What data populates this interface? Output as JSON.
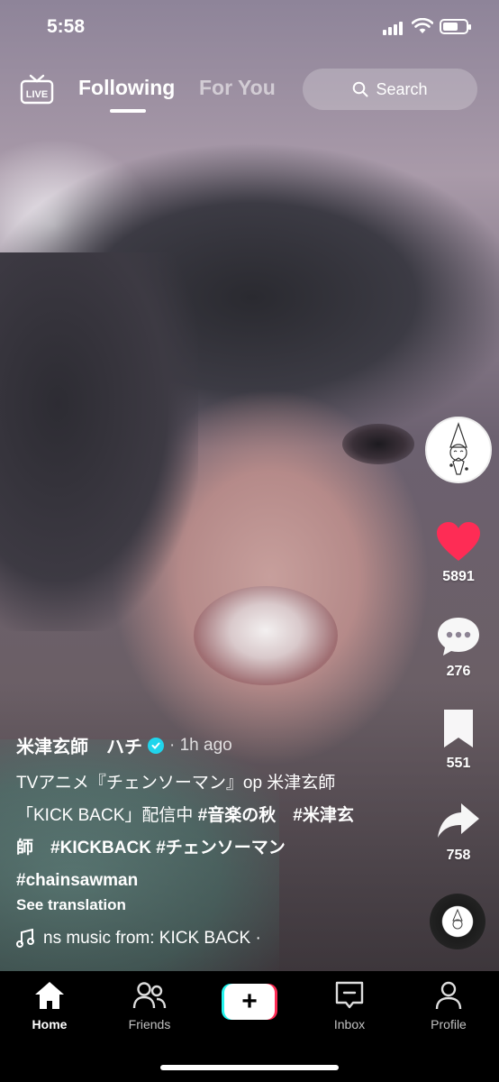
{
  "status_bar": {
    "time": "5:58"
  },
  "top_nav": {
    "live_label": "LIVE",
    "tabs": [
      {
        "label": "Following",
        "active": true
      },
      {
        "label": "For You",
        "active": false
      }
    ],
    "search_label": "Search"
  },
  "rail": {
    "likes": "5891",
    "comments": "276",
    "saves": "551",
    "shares": "758"
  },
  "post": {
    "username": "米津玄師　ハチ",
    "time_ago": "· 1h ago",
    "caption_text_1": "TVアニメ『チェンソーマン』op 米津玄師「KICK BACK」配信中 ",
    "caption_tags": [
      "#音楽の秋",
      "#米津玄師",
      "#KICKBACK",
      "#チェンソーマン",
      "#chainsawman"
    ],
    "see_translation": "See translation",
    "music": "ns music from: KICK BACK ·"
  },
  "bottom_nav": {
    "items": [
      {
        "label": "Home",
        "icon": "home-icon",
        "active": true
      },
      {
        "label": "Friends",
        "icon": "friends-icon",
        "active": false
      },
      {
        "label": "Inbox",
        "icon": "inbox-icon",
        "active": false
      },
      {
        "label": "Profile",
        "icon": "profile-icon",
        "active": false
      }
    ]
  },
  "colors": {
    "like": "#fe2c55",
    "verified": "#20d5ec",
    "create_cyan": "#25f4ee",
    "create_red": "#fe2c55"
  }
}
